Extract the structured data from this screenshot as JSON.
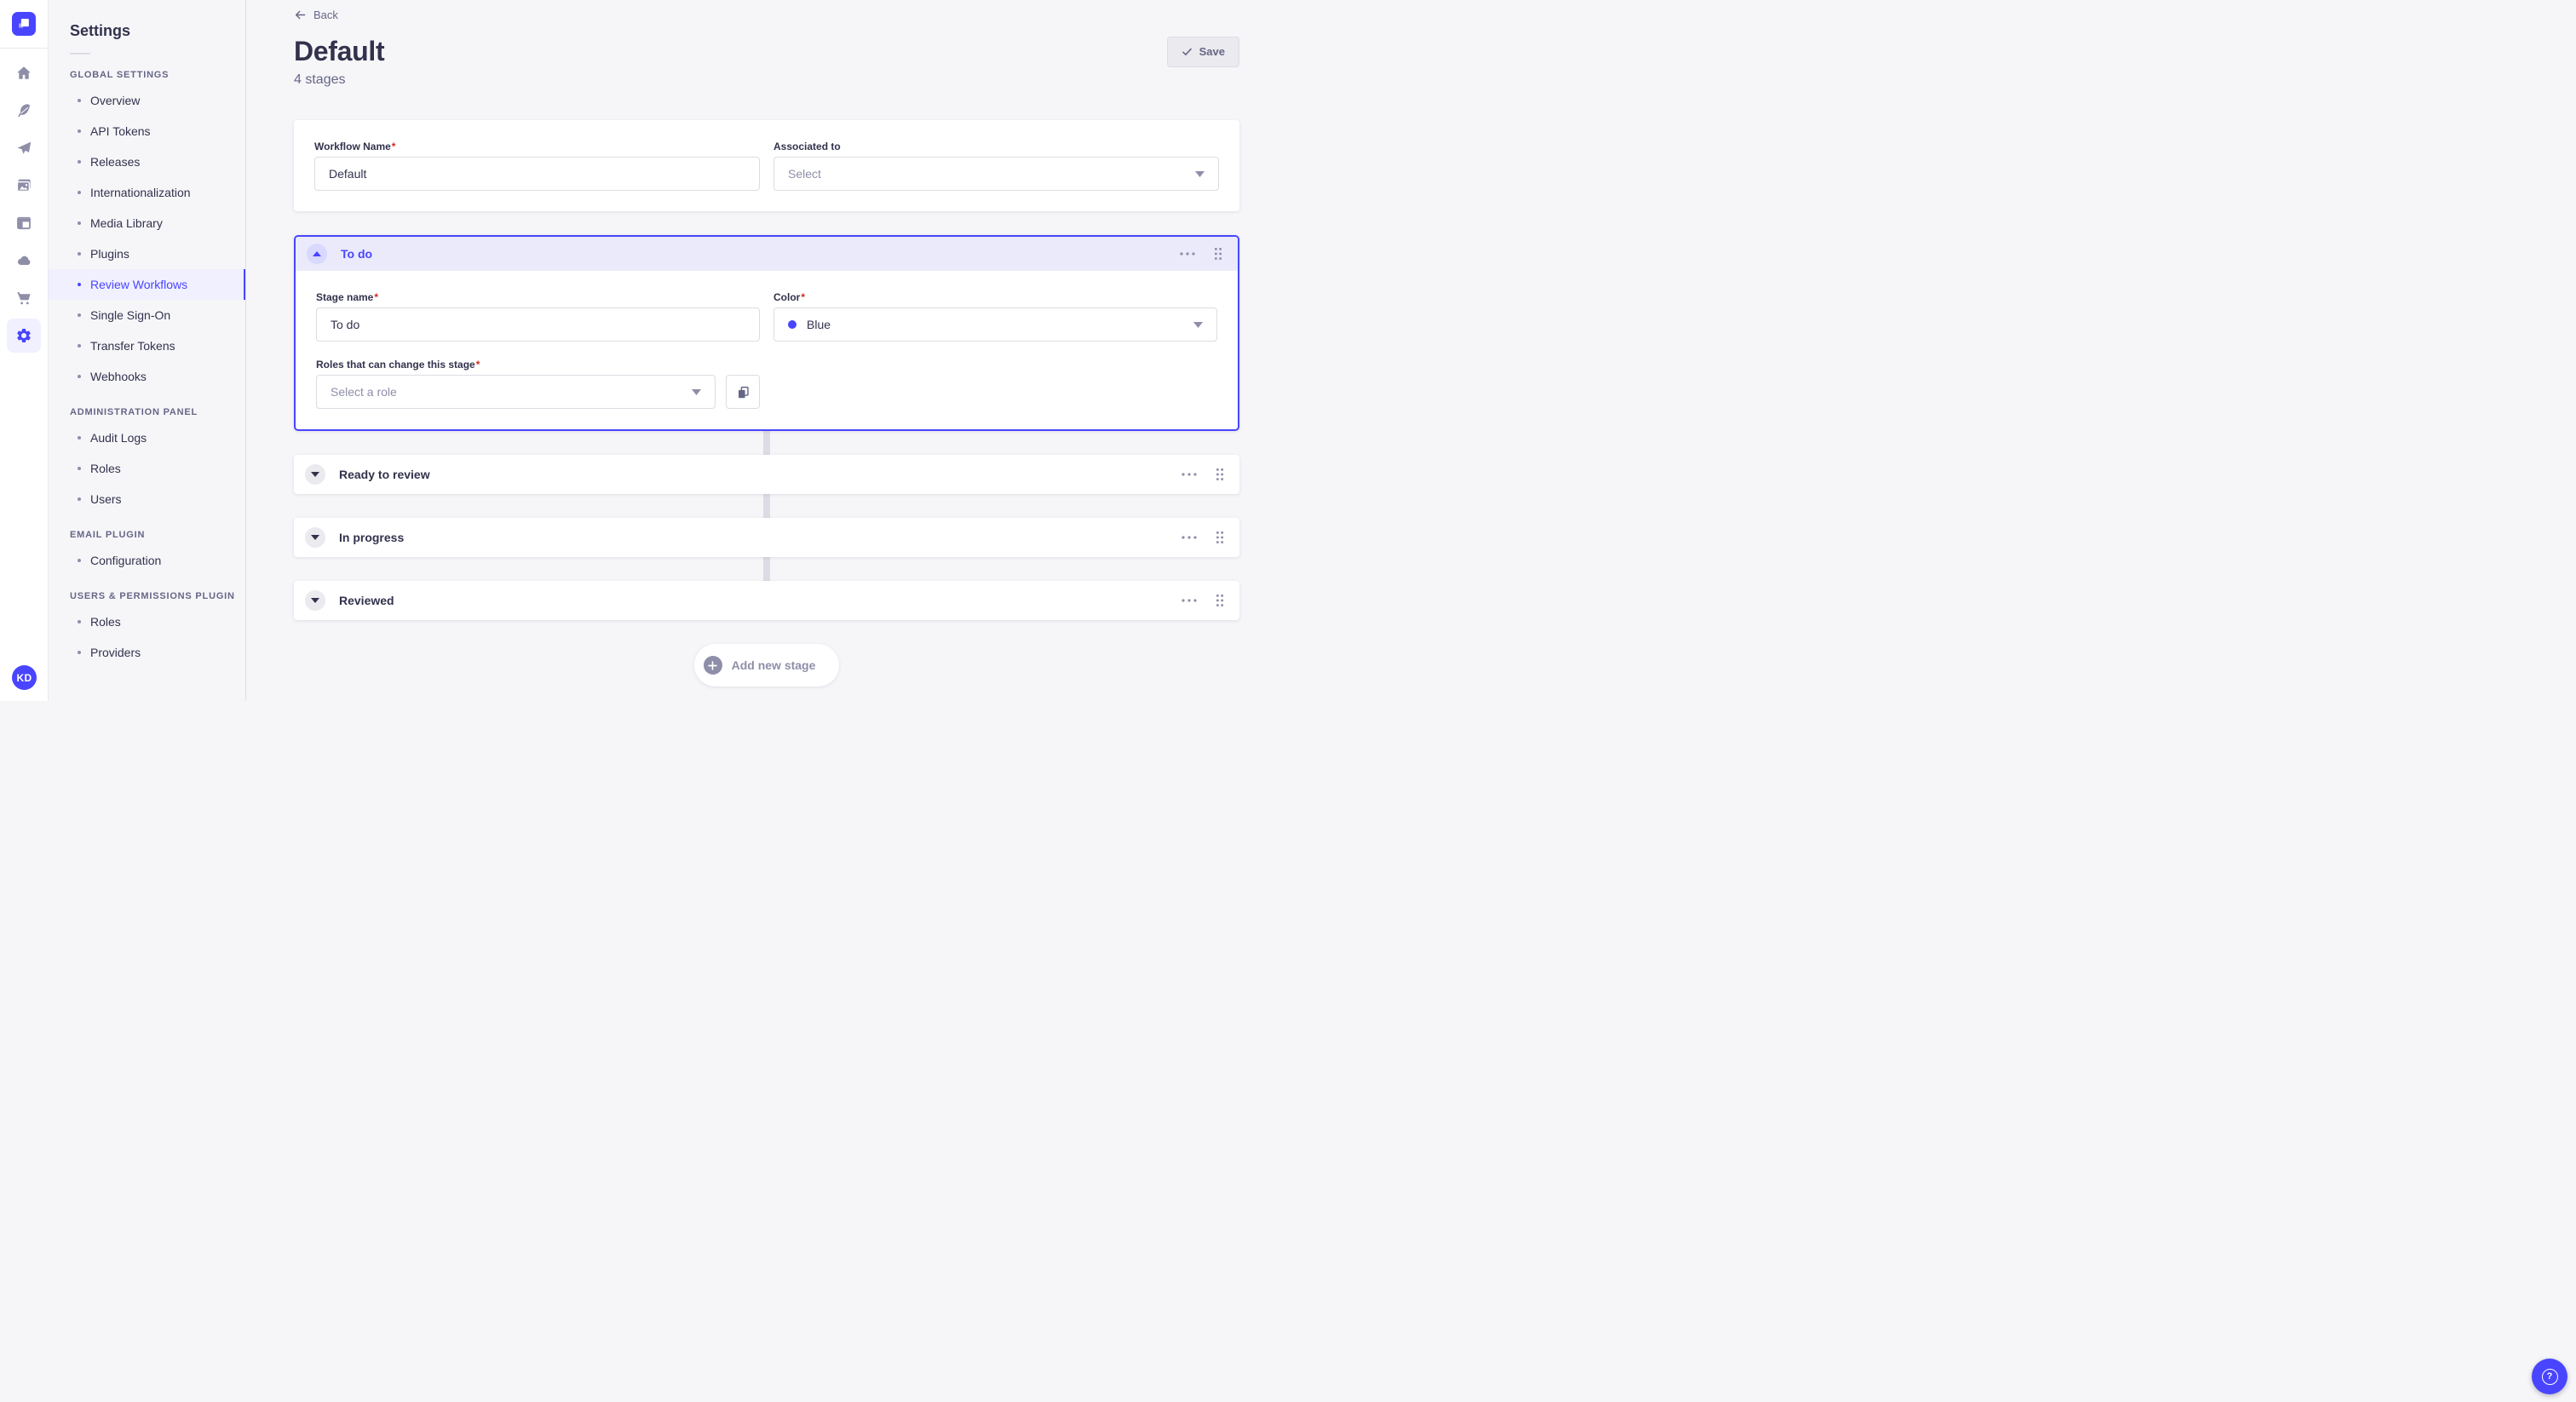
{
  "colors": {
    "primary": "#4945FF",
    "subnav_active_bg": "#F0F0FF",
    "stage_header_bg": "#EAEAFB",
    "stage_border": "#4945FF",
    "connector": "#DCDCE4",
    "required_asterisk": "#D02B20",
    "stage_color_dot": "#4945FF"
  },
  "required_mark": "*",
  "rail": {
    "logo_icon": "strapi-logo",
    "icons": [
      "home-icon",
      "feather-icon",
      "paper-plane-icon",
      "images-icon",
      "layout-icon",
      "cloud-icon",
      "cart-icon",
      "gear-icon"
    ],
    "active_icon": "gear-icon",
    "avatar_initials": "KD"
  },
  "subnav": {
    "title": "Settings",
    "sections": [
      {
        "label": "GLOBAL SETTINGS",
        "active_item": "Review Workflows",
        "items": [
          "Overview",
          "API Tokens",
          "Releases",
          "Internationalization",
          "Media Library",
          "Plugins",
          "Review Workflows",
          "Single Sign-On",
          "Transfer Tokens",
          "Webhooks"
        ]
      },
      {
        "label": "ADMINISTRATION PANEL",
        "items": [
          "Audit Logs",
          "Roles",
          "Users"
        ]
      },
      {
        "label": "EMAIL PLUGIN",
        "items": [
          "Configuration"
        ]
      },
      {
        "label": "USERS & PERMISSIONS PLUGIN",
        "items": [
          "Roles",
          "Providers"
        ]
      }
    ]
  },
  "header": {
    "back_label": "Back",
    "title": "Default",
    "subtitle": "4 stages",
    "save_label": "Save"
  },
  "workflow_form": {
    "name_label": "Workflow Name",
    "name_value": "Default",
    "associated_label": "Associated to",
    "associated_placeholder": "Select"
  },
  "stage_editor": {
    "expanded": {
      "title": "To do",
      "stage_name_label": "Stage name",
      "stage_name_value": "To do",
      "color_label": "Color",
      "color_value": "Blue",
      "roles_label": "Roles that can change this stage",
      "roles_placeholder": "Select a role"
    },
    "collapsed": [
      {
        "title": "Ready to review"
      },
      {
        "title": "In progress"
      },
      {
        "title": "Reviewed"
      }
    ],
    "add_button_label": "Add new stage"
  },
  "help": {
    "glyph": "?"
  }
}
